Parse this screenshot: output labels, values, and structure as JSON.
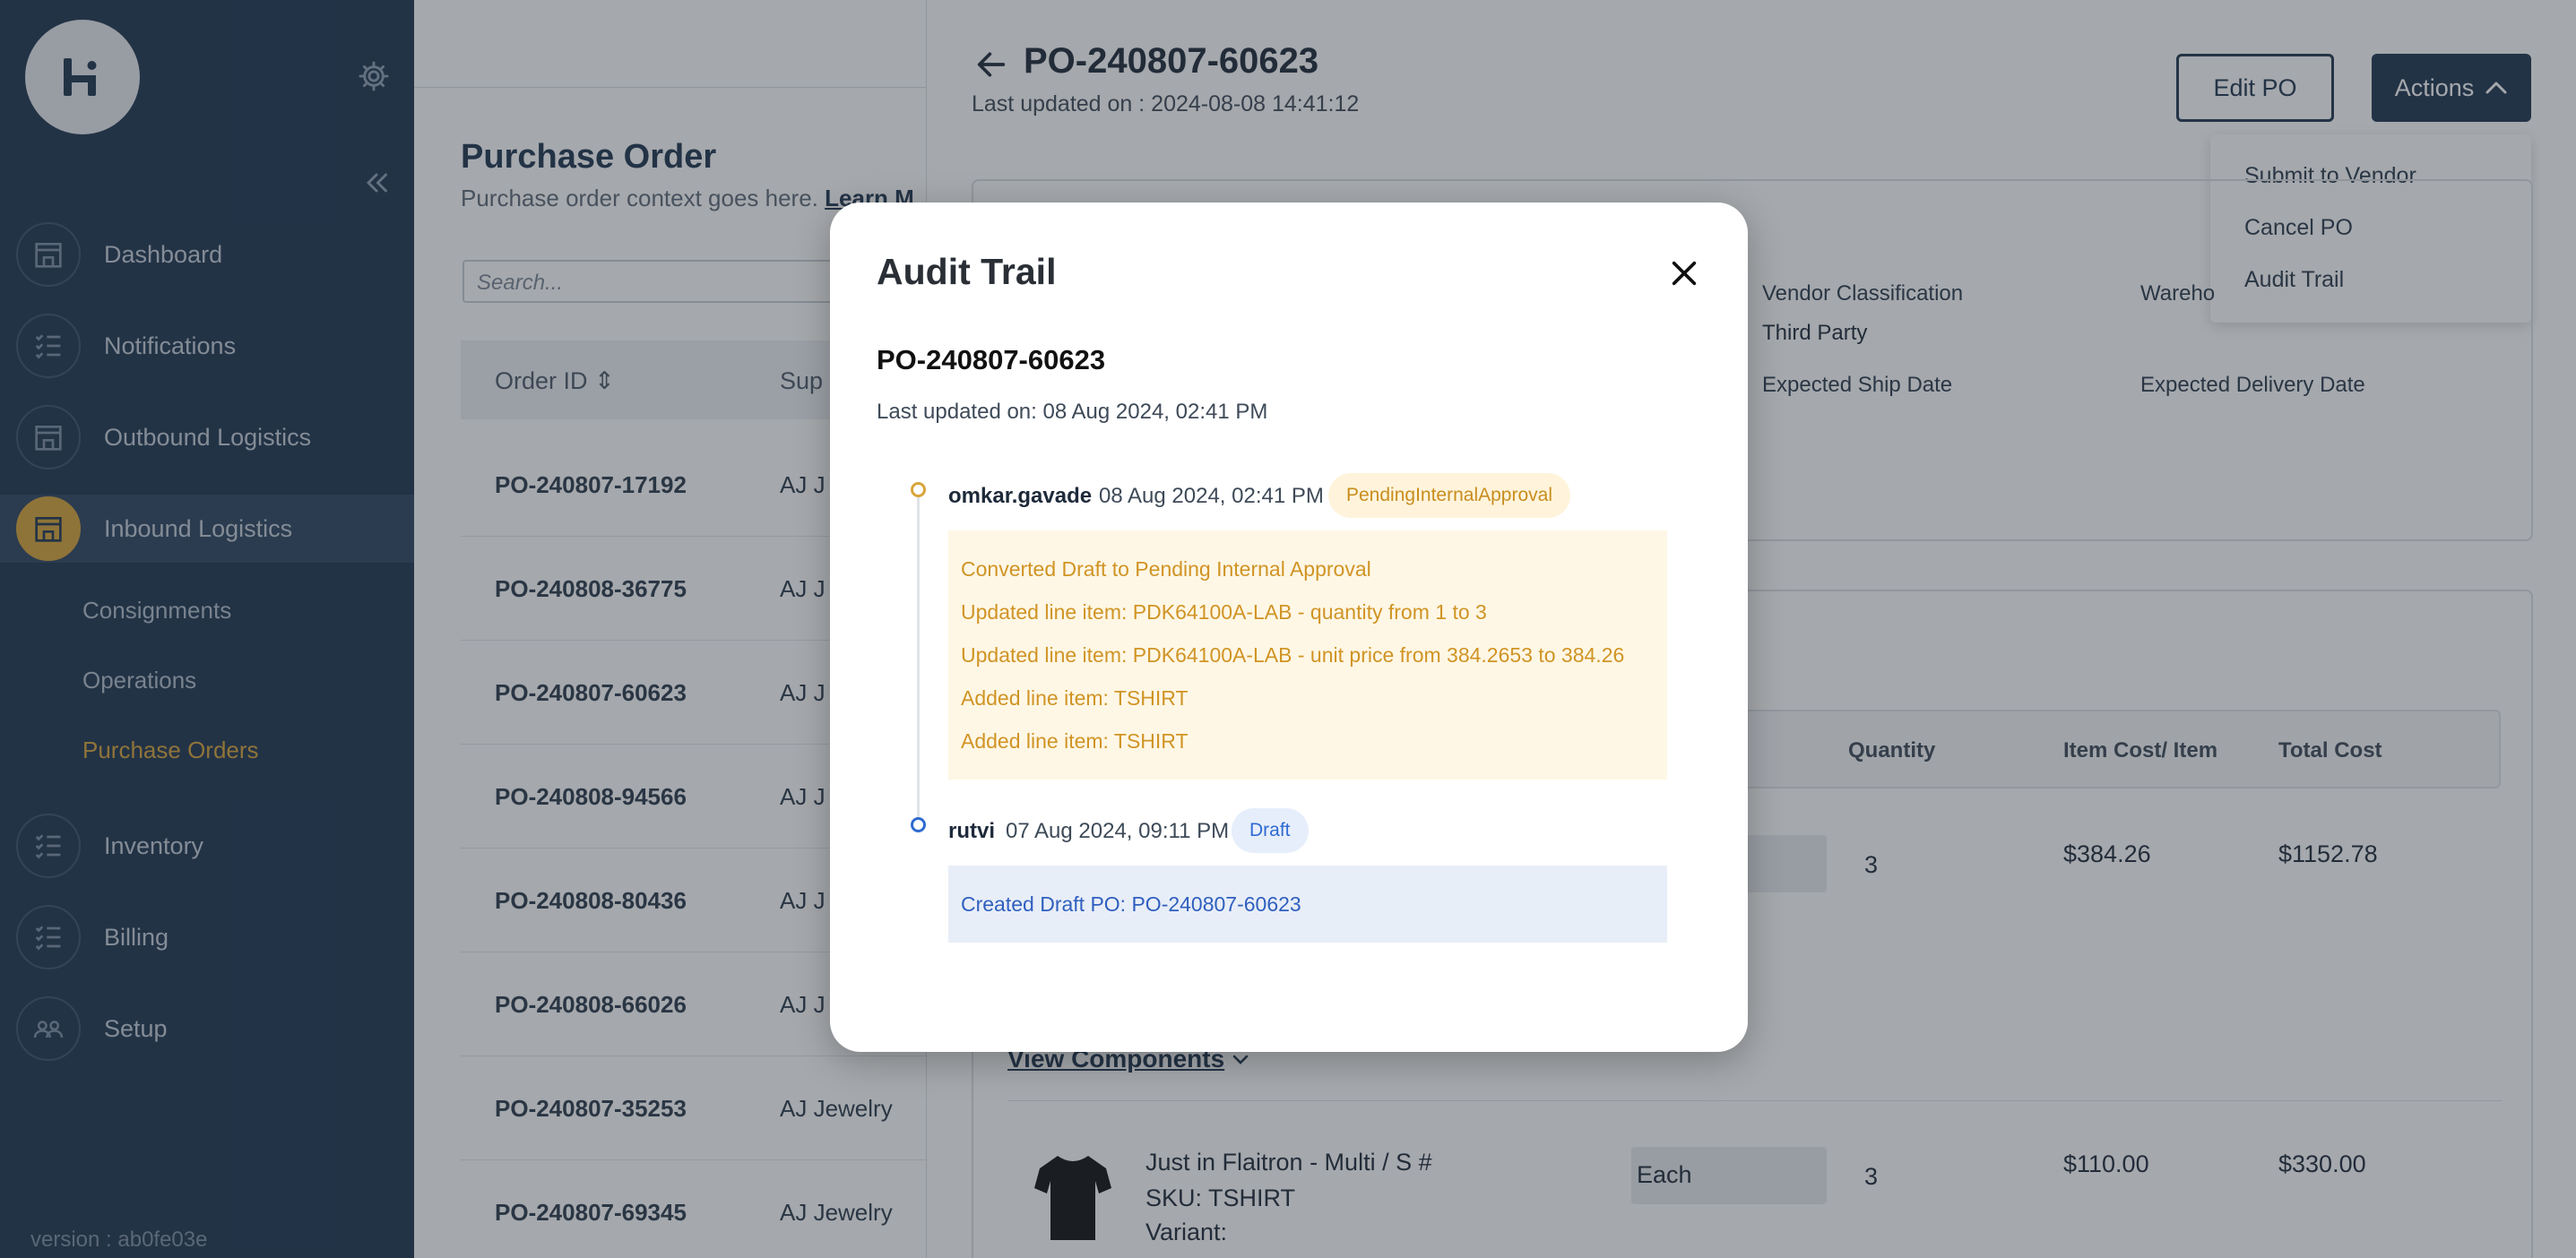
{
  "sidebar": {
    "items": [
      {
        "label": "Dashboard",
        "icon": "building-icon"
      },
      {
        "label": "Notifications",
        "icon": "checklist-icon"
      },
      {
        "label": "Outbound Logistics",
        "icon": "building-icon"
      },
      {
        "label": "Inbound Logistics",
        "icon": "building-icon"
      },
      {
        "label": "Inventory",
        "icon": "checklist-icon"
      },
      {
        "label": "Billing",
        "icon": "checklist-icon"
      },
      {
        "label": "Setup",
        "icon": "people-icon"
      }
    ],
    "sub_items": [
      "Consignments",
      "Operations",
      "Purchase Orders"
    ],
    "version": "version : ab0fe03e"
  },
  "list": {
    "title": "Purchase Order",
    "subtitle": "Purchase order context goes here.",
    "learn_more": "Learn M",
    "search_placeholder": "Search...",
    "columns": [
      "Order ID",
      "Sup"
    ],
    "rows": [
      {
        "id": "PO-240807-17192",
        "supplier": "AJ J"
      },
      {
        "id": "PO-240808-36775",
        "supplier": "AJ J"
      },
      {
        "id": "PO-240807-60623",
        "supplier": "AJ J"
      },
      {
        "id": "PO-240808-94566",
        "supplier": "AJ J"
      },
      {
        "id": "PO-240808-80436",
        "supplier": "AJ J"
      },
      {
        "id": "PO-240808-66026",
        "supplier": "AJ J"
      },
      {
        "id": "PO-240807-35253",
        "supplier": "AJ Jewelry"
      },
      {
        "id": "PO-240807-69345",
        "supplier": "AJ Jewelry"
      }
    ]
  },
  "detail": {
    "po_number": "PO-240807-60623",
    "last_updated": "Last updated on : 2024-08-08 14:41:12",
    "edit_label": "Edit PO",
    "actions_label": "Actions",
    "dropdown": [
      "Submit to Vendor",
      "Cancel PO",
      "Audit Trail"
    ],
    "fields": {
      "vendor_classification_label": "Vendor Classification",
      "vendor_classification_value": "Third Party",
      "warehouse_label": "Wareho",
      "expected_ship_label": "Expected Ship Date",
      "expected_delivery_label": "Expected Delivery Date"
    },
    "items_columns": [
      "Quantity",
      "Item Cost/ Item",
      "Total Cost"
    ],
    "item1": {
      "quantity": "3",
      "unit_cost": "$384.26",
      "total": "$1152.78"
    },
    "view_components": "View Components",
    "item2": {
      "name": "Just in Flaitron - Multi / S #",
      "sku": "SKU: TSHIRT",
      "variant": "Variant:",
      "unit": "Each",
      "quantity": "3",
      "unit_cost": "$110.00",
      "total": "$330.00"
    }
  },
  "modal": {
    "title": "Audit Trail",
    "po_number": "PO-240807-60623",
    "last_updated": "Last updated on: 08 Aug 2024, 02:41 PM",
    "entries": [
      {
        "user": "omkar.gavade",
        "time": "08 Aug 2024, 02:41 PM",
        "status": "PendingInternalApproval",
        "lines": [
          "Converted Draft to Pending Internal Approval",
          "Updated line item: PDK64100A-LAB - quantity from 1 to 3",
          "Updated line item: PDK64100A-LAB - unit price from 384.2653 to 384.26",
          "Added line item: TSHIRT",
          "Added line item: TSHIRT"
        ]
      },
      {
        "user": "rutvi",
        "time": "07 Aug 2024, 09:11 PM",
        "status": "Draft",
        "lines": [
          "Created Draft PO: PO-240807-60623"
        ]
      }
    ]
  },
  "colors": {
    "sidebar_bg": "#1f3650",
    "accent_gold": "#d9a53a",
    "pending_text": "#d09425",
    "draft_text": "#2f6bd1"
  }
}
